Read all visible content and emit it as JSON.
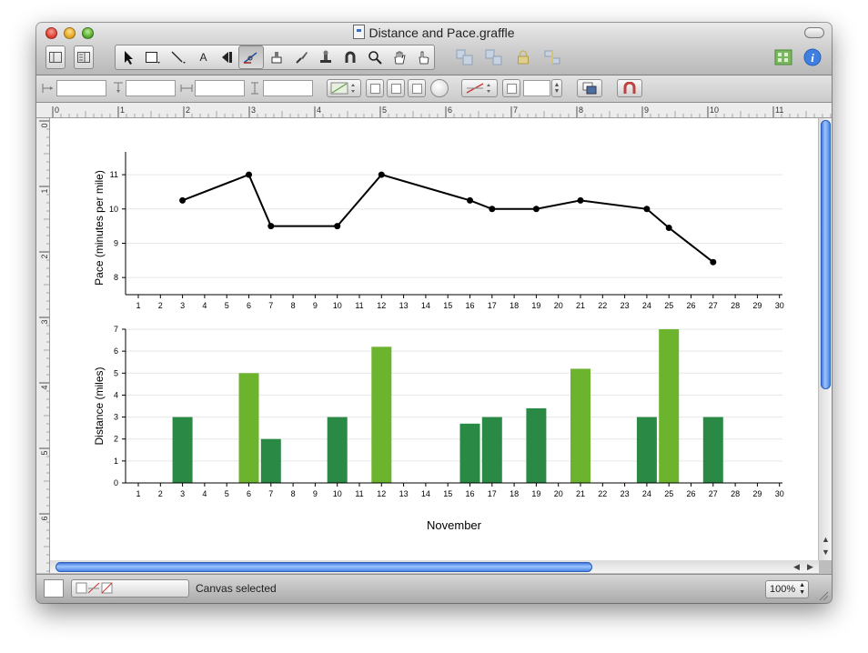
{
  "window": {
    "title": "Distance and Pace.graffle"
  },
  "toolbar": {
    "text_tool_label": "A",
    "tools": [
      "sidebar-toggle-icon",
      "drawer-toggle-icon",
      "pointer-icon",
      "rectangle-icon",
      "line-icon",
      "text-tool-icon",
      "back-arrow-icon",
      "pen-icon",
      "style-brush-icon",
      "paint-icon",
      "stamp-icon",
      "magnet-icon",
      "zoom-icon",
      "hand-icon",
      "browse-hand-icon",
      "group-icon",
      "ungroup-icon",
      "lock-icon",
      "align-icon",
      "grid-icon",
      "info-icon"
    ]
  },
  "ruler": {
    "h_ticks": [
      "0",
      "1",
      "2",
      "3",
      "4",
      "5",
      "6",
      "7",
      "8",
      "9",
      "10",
      "11"
    ],
    "v_ticks": [
      "0",
      "1",
      "2",
      "3",
      "4",
      "5",
      "6"
    ]
  },
  "status": {
    "message": "Canvas selected",
    "zoom": "100%"
  },
  "colors": {
    "line": "#000000",
    "bar_dark": "#2a8a45",
    "bar_light": "#6cb32e",
    "accent_scroll": "#3c78e0"
  },
  "chart_data": [
    {
      "type": "line",
      "ylabel": "Pace (minutes per mile)",
      "xlabel": "",
      "x_ticks": [
        1,
        2,
        3,
        4,
        5,
        6,
        7,
        8,
        9,
        10,
        11,
        12,
        13,
        14,
        15,
        16,
        17,
        18,
        19,
        20,
        21,
        22,
        23,
        24,
        25,
        26,
        27,
        28,
        29,
        30
      ],
      "y_ticks": [
        8,
        9,
        10,
        11
      ],
      "xlim": [
        1,
        30
      ],
      "ylim": [
        7.5,
        11.4
      ],
      "points": [
        {
          "x": 3,
          "y": 10.25
        },
        {
          "x": 6,
          "y": 11.0
        },
        {
          "x": 7,
          "y": 9.5
        },
        {
          "x": 10,
          "y": 9.5
        },
        {
          "x": 12,
          "y": 11.0
        },
        {
          "x": 16,
          "y": 10.25
        },
        {
          "x": 17,
          "y": 10.0
        },
        {
          "x": 19,
          "y": 10.0
        },
        {
          "x": 21,
          "y": 10.25
        },
        {
          "x": 24,
          "y": 10.0
        },
        {
          "x": 25,
          "y": 9.45
        },
        {
          "x": 27,
          "y": 8.45
        }
      ],
      "grid": true
    },
    {
      "type": "bar",
      "ylabel": "Distance (miles)",
      "xlabel": "November",
      "x_ticks": [
        1,
        2,
        3,
        4,
        5,
        6,
        7,
        8,
        9,
        10,
        11,
        12,
        13,
        14,
        15,
        16,
        17,
        18,
        19,
        20,
        21,
        22,
        23,
        24,
        25,
        26,
        27,
        28,
        29,
        30
      ],
      "y_ticks": [
        0,
        1,
        2,
        3,
        4,
        5,
        6,
        7
      ],
      "xlim": [
        1,
        30
      ],
      "ylim": [
        0,
        7
      ],
      "bars": [
        {
          "x": 3,
          "value": 3.0,
          "shade": "dark"
        },
        {
          "x": 6,
          "value": 5.0,
          "shade": "light"
        },
        {
          "x": 7,
          "value": 2.0,
          "shade": "dark"
        },
        {
          "x": 10,
          "value": 3.0,
          "shade": "dark"
        },
        {
          "x": 12,
          "value": 6.2,
          "shade": "light"
        },
        {
          "x": 16,
          "value": 2.7,
          "shade": "dark"
        },
        {
          "x": 17,
          "value": 3.0,
          "shade": "dark"
        },
        {
          "x": 19,
          "value": 3.4,
          "shade": "dark"
        },
        {
          "x": 21,
          "value": 5.2,
          "shade": "light"
        },
        {
          "x": 24,
          "value": 3.0,
          "shade": "dark"
        },
        {
          "x": 25,
          "value": 7.0,
          "shade": "light"
        },
        {
          "x": 27,
          "value": 3.0,
          "shade": "dark"
        }
      ],
      "grid": true
    }
  ]
}
